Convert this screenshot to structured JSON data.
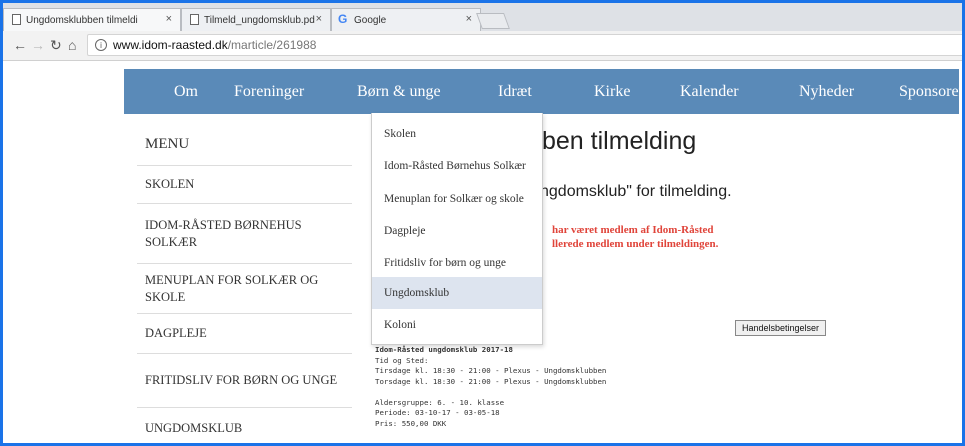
{
  "browser": {
    "tabs": [
      {
        "title": "Ungdomsklubben tilmeldi",
        "icon": "page-icon"
      },
      {
        "title": "Tilmeld_ungdomsklub.pd",
        "icon": "page-icon"
      },
      {
        "title": "Google",
        "icon": "google-icon"
      }
    ],
    "close_glyph": "×",
    "url_host": "www.idom-raasted.dk",
    "url_path": "/marticle/261988"
  },
  "nav": [
    "Om",
    "Foreninger",
    "Børn & unge",
    "Idræt",
    "Kirke",
    "Kalender",
    "Nyheder",
    "Sponsorer"
  ],
  "sidebar": {
    "title": "MENU",
    "items": [
      {
        "label": "SKOLEN"
      },
      {
        "label": "IDOM-RÅSTED BØRNEHUS SOLKÆR"
      },
      {
        "label": "MENUPLAN FOR SOLKÆR OG SKOLE"
      },
      {
        "label": "DAGPLEJE"
      },
      {
        "label": "FRITIDSLIV FOR BØRN OG UNGE"
      },
      {
        "label": "UNGDOMSKLUB"
      }
    ]
  },
  "dropdown": {
    "items": [
      {
        "label": "Skolen"
      },
      {
        "label": "Idom-Råsted Børnehus Solkær"
      },
      {
        "label": "Menuplan for Solkær og skole"
      },
      {
        "label": "Dagpleje"
      },
      {
        "label": "Fritidsliv for børn og unge"
      },
      {
        "label": "Ungdomsklub"
      },
      {
        "label": "Koloni"
      }
    ],
    "highlighted": "Ungdomsklub"
  },
  "main": {
    "heading": "ben tilmelding",
    "subline": "ngdomsklub\" for tilmelding.",
    "warning": [
      "har været medlem af Idom-Råsted",
      "llerede medlem under tilmeldingen."
    ],
    "button": "Handelsbetingelser",
    "info": {
      "title": "Idom-Råsted ungdomsklub 2017-18",
      "lines": [
        "Tid og Sted:",
        "Tirsdage kl. 18:30 - 21:00 - Plexus - Ungdomsklubben",
        "Torsdage kl. 18:30 - 21:00 - Plexus - Ungdomsklubben",
        "",
        "Aldersgruppe: 6. - 10. klasse",
        "Periode: 03-10-17 - 03-05-18",
        "Pris: 550,00 DKK"
      ]
    }
  },
  "colors": {
    "navbar": "#5a8ab8",
    "warning": "#e0443a",
    "highlight": "#dde4ef",
    "frame": "#1a73e8"
  }
}
